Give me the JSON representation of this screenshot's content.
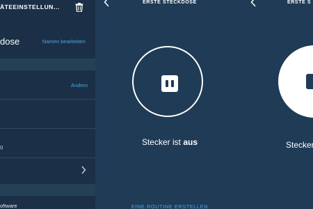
{
  "settings_panel": {
    "header_title": "ÄTEEINSTELLUN…",
    "device_name": "dose",
    "rename_label": "Namen bearbeiten",
    "change_label": "Ändern",
    "small_text": "g",
    "software_label": "oftware"
  },
  "device_panel": {
    "title": "ERSTE STECKDOSE",
    "status_prefix": "Stecker ist ",
    "status_value": "aus",
    "routine_label": "EINE ROUTINE ERSTELLEN"
  },
  "device_panel_partial": {
    "title": "ERSTE S",
    "status_text": "Stecker"
  },
  "colors": {
    "background_left": "#1b3046",
    "background_right": "#1f3b56",
    "accent_link": "#4aa3e8",
    "white": "#ffffff"
  }
}
